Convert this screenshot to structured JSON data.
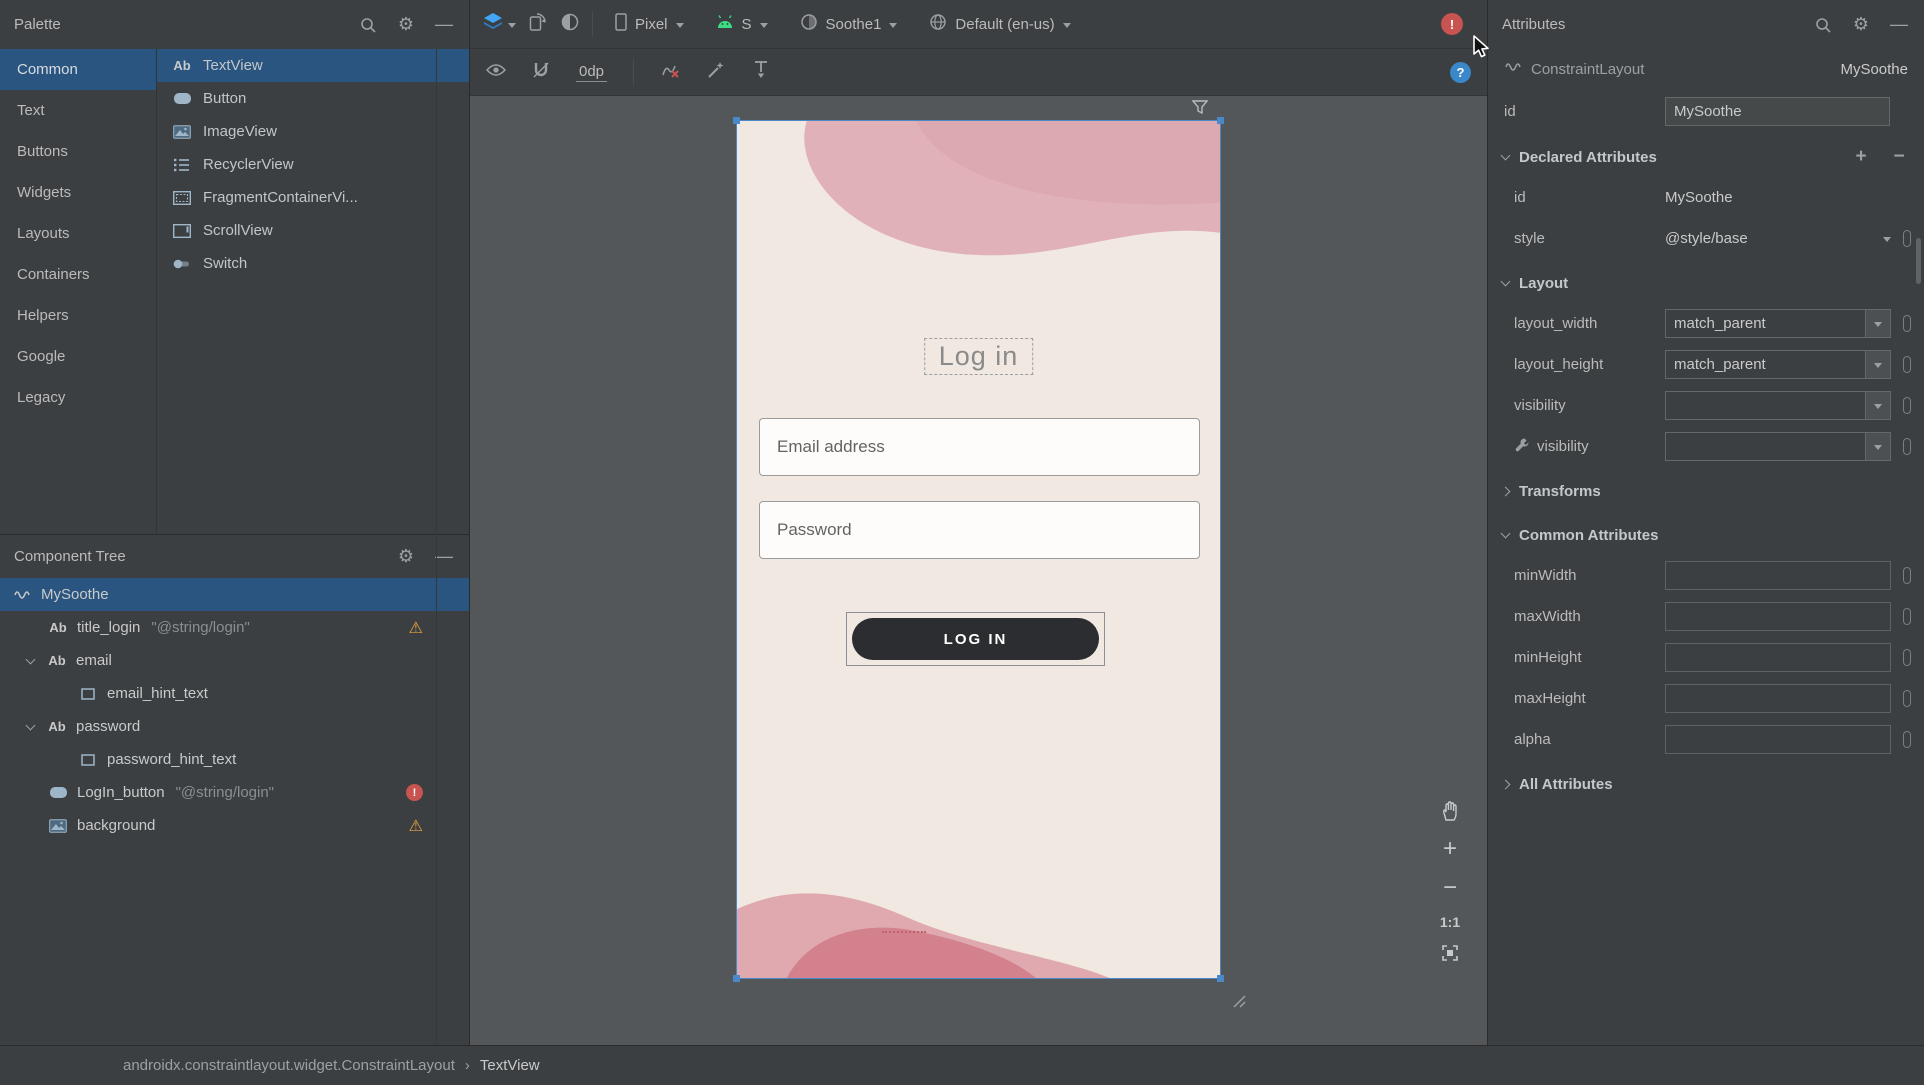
{
  "icons": {
    "gear": "⚙",
    "minimize": "—",
    "plus": "+",
    "minus": "−",
    "warning": "⚠",
    "error_mark": "!",
    "help_mark": "?",
    "textview_ab": "Ab",
    "breadcrumb_sep": "›"
  },
  "colors": {
    "panel_bg": "#3C3F41",
    "canvas_bg": "#53575A",
    "selection_blue": "#2A5580",
    "accent_blue": "#42A5F5",
    "error_red": "#C75450",
    "warning_yellow": "#E8A33D",
    "android_green": "#3DDC84",
    "design_bg": "#F1E9E1",
    "blob_pink": "#E0B2B8",
    "blob_rose": "#D2818D",
    "button_dark": "#2B2D30"
  },
  "palette": {
    "title": "Palette",
    "categories": [
      "Common",
      "Text",
      "Buttons",
      "Widgets",
      "Layouts",
      "Containers",
      "Helpers",
      "Google",
      "Legacy"
    ],
    "components": [
      "TextView",
      "Button",
      "ImageView",
      "RecyclerView",
      "FragmentContainerVi...",
      "ScrollView",
      "Switch"
    ]
  },
  "component_tree": {
    "title": "Component Tree",
    "items": [
      {
        "label": "MySoothe"
      },
      {
        "label": "title_login",
        "hint": "\"@string/login\""
      },
      {
        "label": "email"
      },
      {
        "label": "email_hint_text"
      },
      {
        "label": "password"
      },
      {
        "label": "password_hint_text"
      },
      {
        "label": "LogIn_button",
        "hint": "\"@string/login\""
      },
      {
        "label": "background"
      }
    ]
  },
  "toolbar": {
    "device": "Pixel",
    "api": "S",
    "theme": "Soothe1",
    "locale": "Default (en-us)",
    "margin": "0dp"
  },
  "design": {
    "title": "Log in",
    "email_hint": "Email address",
    "password_hint": "Password",
    "login_button": "LOG IN"
  },
  "zoom": {
    "actual_size": "1:1"
  },
  "attributes": {
    "title": "Attributes",
    "component_type": "ConstraintLayout",
    "component_id": "MySoothe",
    "id_label": "id",
    "id_value": "MySoothe",
    "sections": {
      "declared": "Declared Attributes",
      "layout": "Layout",
      "transforms": "Transforms",
      "common": "Common Attributes",
      "all": "All Attributes"
    },
    "declared_rows": [
      {
        "name": "id",
        "value": "MySoothe"
      },
      {
        "name": "style",
        "value": "@style/base"
      }
    ],
    "layout_rows": [
      {
        "name": "layout_width",
        "value": "match_parent"
      },
      {
        "name": "layout_height",
        "value": "match_parent"
      },
      {
        "name": "visibility",
        "value": ""
      },
      {
        "name": "visibility",
        "value": ""
      }
    ],
    "common_rows": [
      {
        "name": "minWidth",
        "value": ""
      },
      {
        "name": "maxWidth",
        "value": ""
      },
      {
        "name": "minHeight",
        "value": ""
      },
      {
        "name": "maxHeight",
        "value": ""
      },
      {
        "name": "alpha",
        "value": ""
      }
    ]
  },
  "status_bar": {
    "path_root": "androidx.constraintlayout.widget.ConstraintLayout",
    "path_leaf": "TextView"
  }
}
